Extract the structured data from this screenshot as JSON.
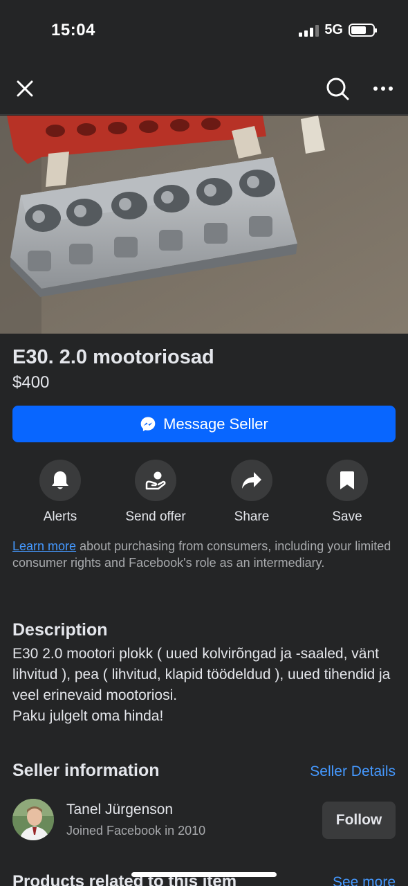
{
  "status": {
    "time": "15:04",
    "network": "5G"
  },
  "listing": {
    "title": "E30. 2.0 mootoriosad",
    "price": "$400",
    "message_button": "Message Seller"
  },
  "actions": [
    {
      "label": "Alerts",
      "icon": "bell-icon"
    },
    {
      "label": "Send offer",
      "icon": "offer-icon"
    },
    {
      "label": "Share",
      "icon": "share-icon"
    },
    {
      "label": "Save",
      "icon": "bookmark-icon"
    }
  ],
  "notice": {
    "link": "Learn more",
    "text": " about purchasing from consumers, including your limited consumer rights and Facebook's role as an intermediary."
  },
  "description": {
    "heading": "Description",
    "line1": "E30 2.0 mootori plokk ( uued kolvirõngad ja -saaled, vänt lihvitud ), pea ( lihvitud, klapid töödeldud ), uued tihendid ja veel erinevaid mootoriosi.",
    "line2": "Paku julgelt oma hinda!"
  },
  "seller": {
    "heading": "Seller information",
    "details_link": "Seller Details",
    "name": "Tanel Jürgenson",
    "joined": "Joined Facebook in 2010",
    "follow": "Follow"
  },
  "related": {
    "heading": "Products related to this item",
    "see_more": "See more"
  },
  "colors": {
    "accent": "#0866ff",
    "link": "#4599ff",
    "background": "#242526"
  }
}
